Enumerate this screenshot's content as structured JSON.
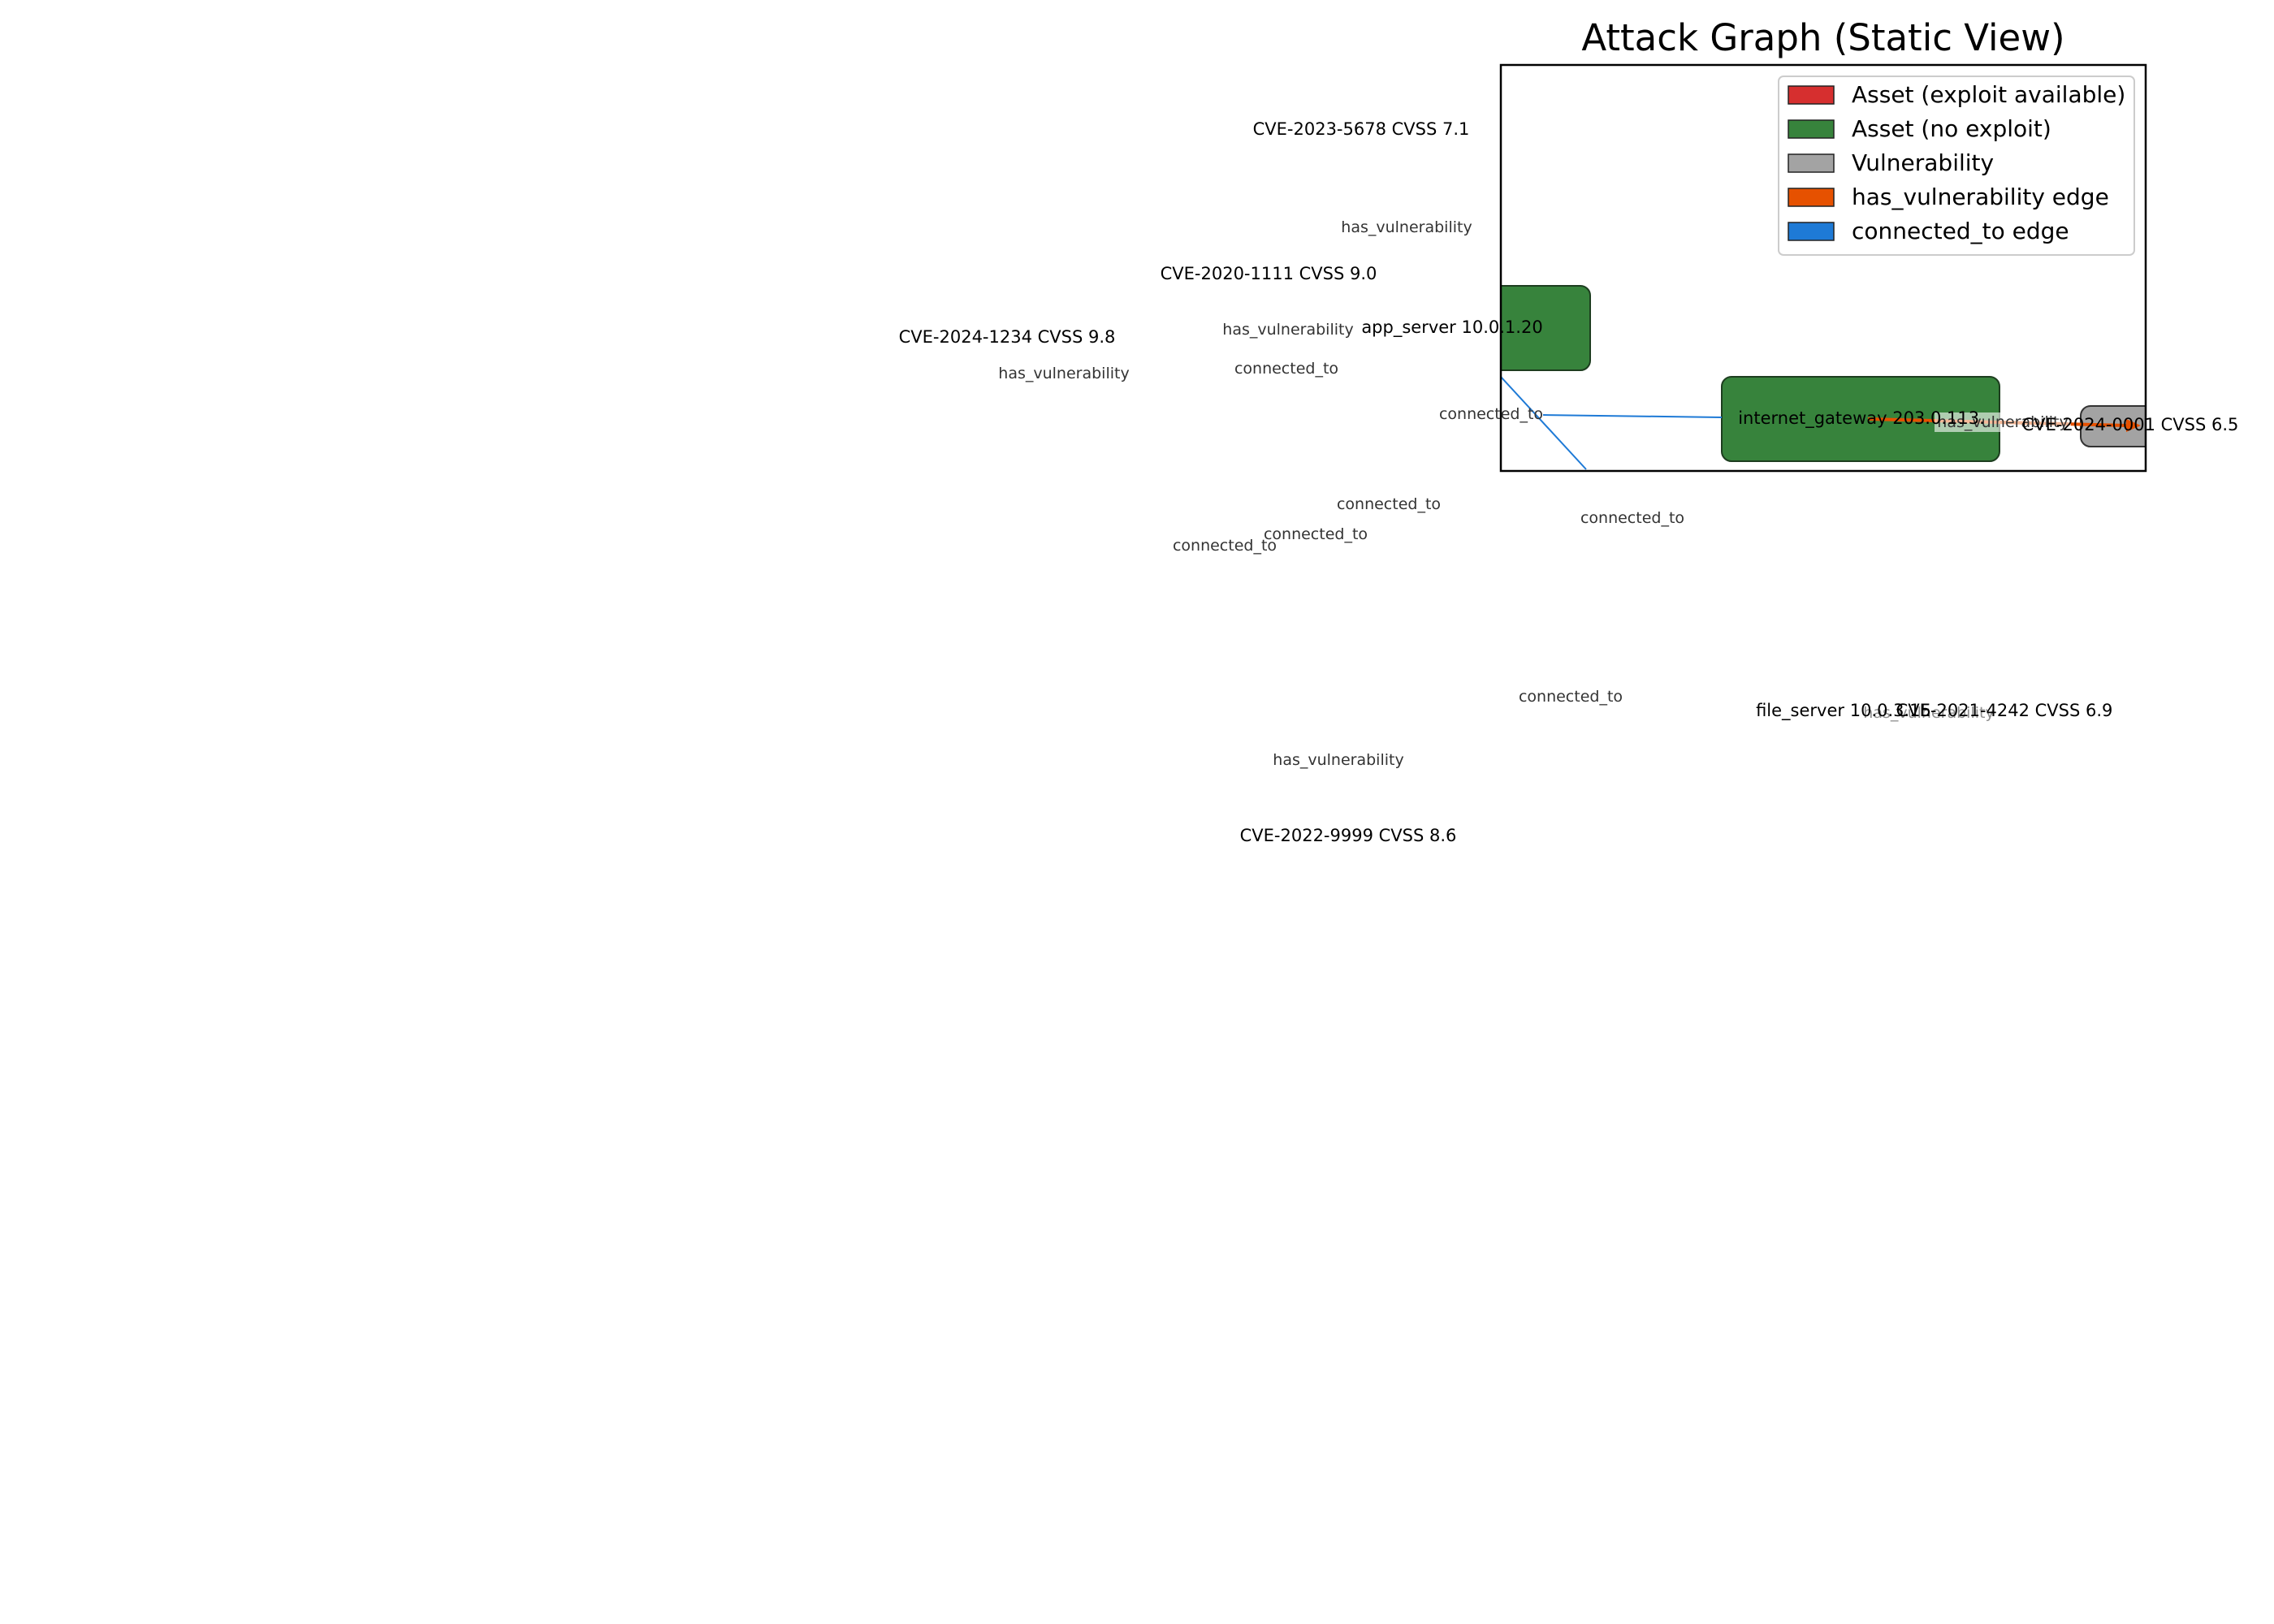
{
  "title": "Attack Graph (Static View)",
  "legend": {
    "asset_exploit": "Asset (exploit available)",
    "asset_no_exploit": "Asset (no exploit)",
    "vulnerability": "Vulnerability",
    "edge_has_vuln": "has_vulnerability edge",
    "edge_connected": "connected_to edge"
  },
  "colors": {
    "asset_exploit": "#d62f2f",
    "asset_no_exploit": "#37833c",
    "vulnerability": "#a3a3a3",
    "edge_has_vuln": "#e65100",
    "edge_connected": "#1e7ad6"
  },
  "nodes": {
    "cve_5678": "CVE-2023-5678  CVSS 7.1",
    "cve_1111": "CVE-2020-1111  CVSS 9.0",
    "cve_1234": "CVE-2024-1234  CVSS 9.8",
    "app_server": "app_server  10.0.1.20",
    "internet_gateway": "internet_gateway  203.0.113.",
    "cve_0001": "CVE-2024-0001  CVSS 6.5",
    "file_server": "file_server  10.0.3.15",
    "cve_4242": "CVE-2021-4242  CVSS 6.9",
    "cve_9999": "CVE-2022-9999  CVSS 8.6"
  },
  "edge_labels": {
    "hv": "has_vulnerability",
    "ct": "connected_to"
  }
}
